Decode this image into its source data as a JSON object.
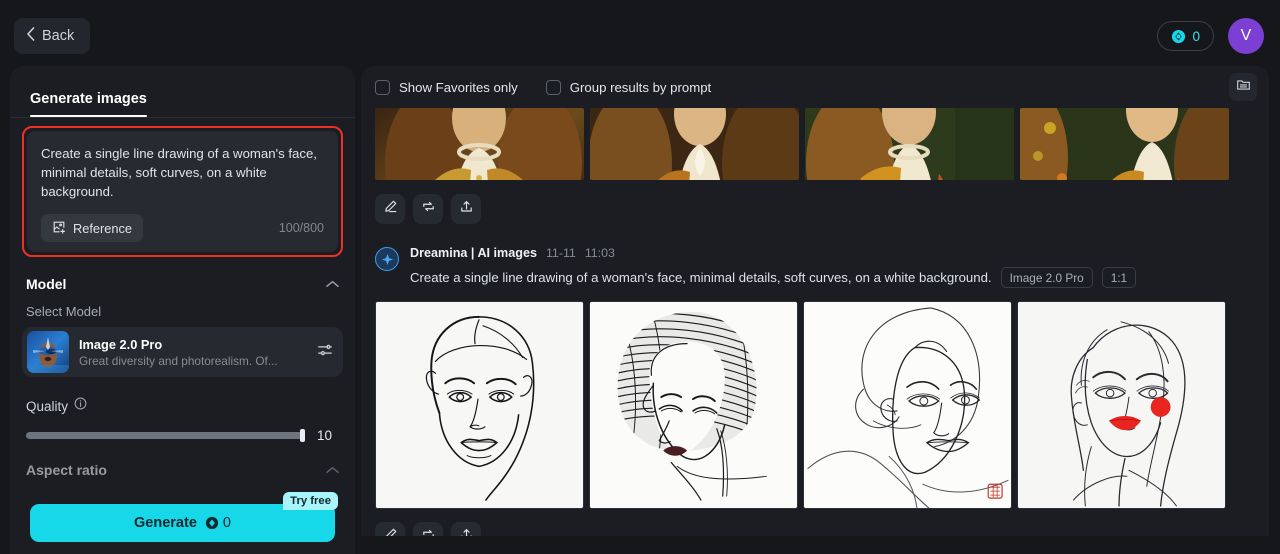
{
  "topbar": {
    "back_label": "Back",
    "credits_value": "0",
    "credits_icon": "coin-icon",
    "avatar_initial": "V",
    "avatar_color": "#7c3fd4",
    "accent_color": "#17d8e8"
  },
  "sidebar": {
    "tab_label": "Generate images",
    "prompt": {
      "text": "Create a single line drawing of a woman's face, minimal details, soft curves, on a white background.",
      "reference_label": "Reference",
      "reference_icon": "add-image-icon",
      "counter": "100/800",
      "highlight_color": "#ef3124"
    },
    "model": {
      "section_title": "Model",
      "select_label": "Select Model",
      "name": "Image 2.0 Pro",
      "description": "Great diversity and photorealism. Of...",
      "settings_icon": "sliders-icon",
      "collapse_icon": "chevron-up-icon"
    },
    "quality": {
      "label": "Quality",
      "info_icon": "info-icon",
      "value": "10",
      "slider_percent": 100
    },
    "aspect": {
      "label": "Aspect ratio",
      "collapse_icon": "chevron-up-icon"
    },
    "generate": {
      "label": "Generate",
      "cost": "0",
      "cost_icon": "coin-icon",
      "badge": "Try free"
    }
  },
  "main": {
    "toolbar": {
      "favorites_label": "Show Favorites only",
      "favorites_checked": false,
      "group_label": "Group results by prompt",
      "group_checked": false,
      "archive_icon": "folder-icon"
    },
    "actions": [
      {
        "name": "edit-button",
        "icon": "pencil-icon"
      },
      {
        "name": "regenerate-button",
        "icon": "swap-arrows-icon"
      },
      {
        "name": "share-button",
        "icon": "upload-icon"
      }
    ],
    "previous_result": {
      "thumbnails": [
        {
          "alt": "renaissance portrait woman gold dress 1"
        },
        {
          "alt": "renaissance portrait woman braided hair 2"
        },
        {
          "alt": "renaissance portrait woman orange sleeve 3"
        },
        {
          "alt": "renaissance portrait woman foliage background 4"
        }
      ]
    },
    "result": {
      "source": "Dreamina | AI images",
      "date": "11-11",
      "time": "11:03",
      "prompt": "Create a single line drawing of a woman's face, minimal details, soft curves, on a white background.",
      "model_chip": "Image 2.0 Pro",
      "ratio_chip": "1:1",
      "badge_icon": "sparkle-icon",
      "images": [
        {
          "alt": "line drawing woman face front facing long hair"
        },
        {
          "alt": "line drawing woman looking down dark wavy hair"
        },
        {
          "alt": "minimal continuous line woman face with red seal stamp"
        },
        {
          "alt": "minimal line woman face red lips red earring"
        }
      ]
    }
  }
}
